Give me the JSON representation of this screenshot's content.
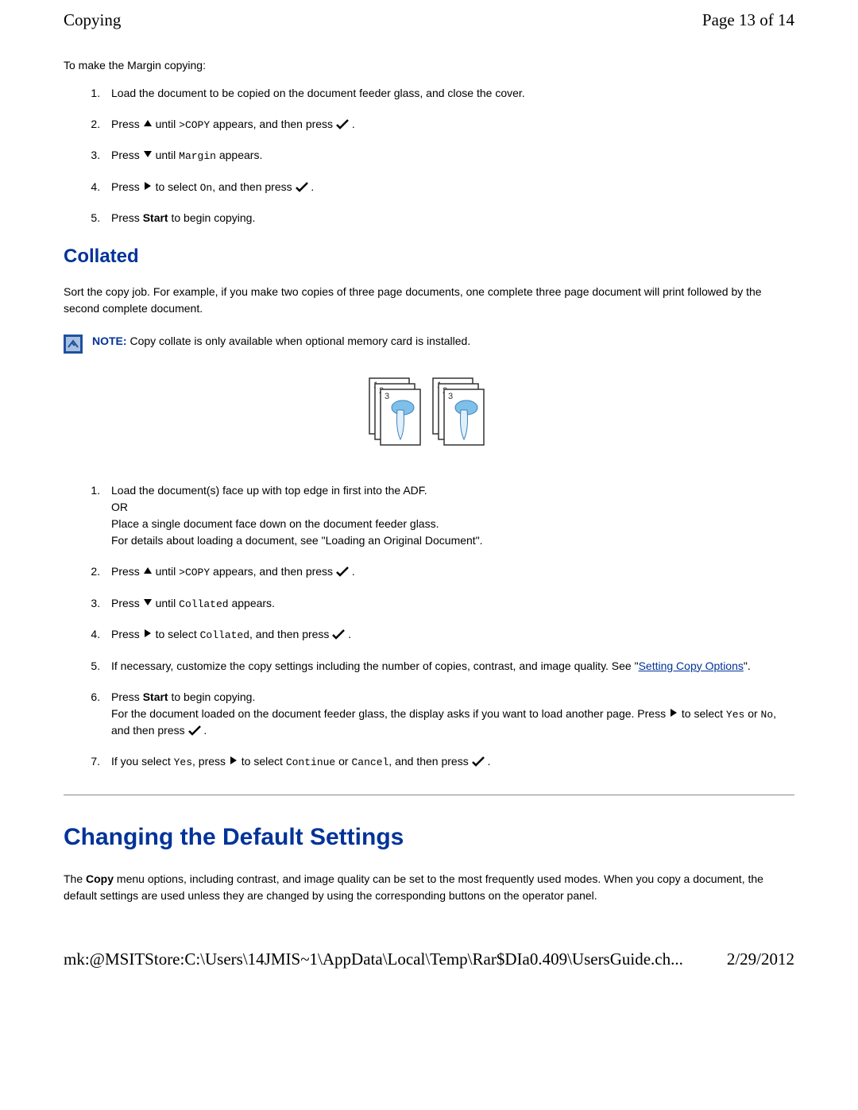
{
  "header": {
    "title": "Copying",
    "page_info": "Page 13 of 14"
  },
  "section1": {
    "intro": "To make the Margin copying:",
    "steps": {
      "step1": "Load the document to be copied on the document feeder glass, and close the cover.",
      "step2_a": "Press ",
      "step2_b": " until ",
      "step2_copy": ">COPY",
      "step2_c": " appears, and then press ",
      "step2_d": " .",
      "step3_a": "Press ",
      "step3_b": " until ",
      "step3_margin": "Margin",
      "step3_c": " appears.",
      "step4_a": "Press ",
      "step4_b": " to select ",
      "step4_on": "On",
      "step4_c": ", and then press ",
      "step4_d": " .",
      "step5_a": "Press ",
      "step5_start": "Start",
      "step5_b": " to begin copying."
    }
  },
  "collated": {
    "heading": "Collated",
    "description": "Sort the copy job. For example, if you make two copies of three page documents, one complete three page document will print followed by the second complete document.",
    "note_label": "NOTE:",
    "note_text": " Copy collate is only available when optional memory card is installed.",
    "steps": {
      "step1_a": "Load the document(s) face up with top edge in first into the ADF.",
      "step1_b": "OR",
      "step1_c": "Place a single document face down on the document feeder glass.",
      "step1_d": "For details about loading a document, see \"Loading an Original Document\".",
      "step2_a": "Press ",
      "step2_b": " until ",
      "step2_copy": ">COPY",
      "step2_c": " appears, and then press ",
      "step2_d": " .",
      "step3_a": "Press ",
      "step3_b": " until ",
      "step3_collated": "Collated",
      "step3_c": " appears.",
      "step4_a": "Press ",
      "step4_b": " to select ",
      "step4_collated": "Collated",
      "step4_c": ", and then press ",
      "step4_d": " .",
      "step5_a": "If necessary, customize the copy settings including the number of copies, contrast, and image quality. See \"",
      "step5_link": "Setting Copy Options",
      "step5_b": "\".",
      "step6_a": "Press ",
      "step6_start": "Start",
      "step6_b": " to begin copying.",
      "step6_c": "For the document loaded on the document feeder glass, the display asks if you want to load another page. Press ",
      "step6_d": " to select ",
      "step6_yes": "Yes",
      "step6_e": " or ",
      "step6_no": "No",
      "step6_f": ", and then press ",
      "step6_g": " .",
      "step7_a": "If you select ",
      "step7_yes": "Yes",
      "step7_b": ", press ",
      "step7_c": " to select ",
      "step7_continue": "Continue",
      "step7_d": " or ",
      "step7_cancel": "Cancel",
      "step7_e": ", and then press ",
      "step7_f": " ."
    }
  },
  "changing": {
    "heading": "Changing the Default Settings",
    "para_a": "The ",
    "para_copy": "Copy",
    "para_b": " menu options, including contrast, and image quality can be set to the most frequently used modes. When you copy a document, the default settings are used unless they are changed by using the corresponding buttons on the operator panel."
  },
  "footer": {
    "path": "mk:@MSITStore:C:\\Users\\14JMIS~1\\AppData\\Local\\Temp\\Rar$DIa0.409\\UsersGuide.ch...",
    "date": "2/29/2012"
  }
}
